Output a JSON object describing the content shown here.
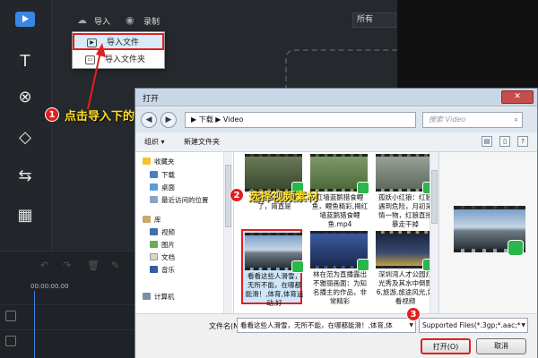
{
  "toolbar": {
    "import_label": "导入",
    "record_label": "录制",
    "filter_value": "所有"
  },
  "dropdown": {
    "items": [
      {
        "label": "导入文件",
        "icon": "play-icon"
      },
      {
        "label": "导入文件夹",
        "icon": "folder-icon"
      }
    ]
  },
  "timeline": {
    "timecode": "00:00:00.00"
  },
  "annotations": {
    "step1": {
      "num": "1",
      "text": "点击导入下的导入文件"
    },
    "step2": {
      "num": "2",
      "text": "选择视频素材"
    },
    "step3": {
      "num": "3"
    }
  },
  "dialog": {
    "title": "打开",
    "path": "▶ 下载 ▶ Video",
    "search_placeholder": "搜索 Video",
    "organize_label": "组织 ▾",
    "new_folder_label": "新建文件夹",
    "nav_items": [
      {
        "label": "收藏夹",
        "group": true
      },
      {
        "label": "下载",
        "group": false
      },
      {
        "label": "桌面",
        "group": false
      },
      {
        "label": "最近访问的位置",
        "group": false
      },
      {
        "label": "库",
        "group": true
      },
      {
        "label": "视频",
        "group": false
      },
      {
        "label": "图片",
        "group": false
      },
      {
        "label": "文档",
        "group": false
      },
      {
        "label": "音乐",
        "group": false
      },
      {
        "label": "计算机",
        "group": true
      }
    ],
    "files": [
      {
        "name": "出水芙蓉，太美了，简直是"
      },
      {
        "name": "红墙蓝鹅猎食鲤鱼，鲤鱼精彩,揭红墙蓝鹅猎食鲤鱼.mp4"
      },
      {
        "name": "孤妖小红狼：红狼遇到危险，月初采情一物，红狼直接暴走干掉"
      },
      {
        "name": "看看这些人滑雪，无所不能，在哪都能滑！,体育,体育运动,好"
      },
      {
        "name": "林在范为直播露出不雅丽画面：为知名播主的作品，非常精彩"
      },
      {
        "name": "深圳湾人才公园灯光秀及其水中倒影6,旅游,旅途风光,好看视频"
      }
    ],
    "filename_label": "文件名(N):",
    "filename_value": "看看这些人滑雪，无所不能，在哪都能滑！,体育,体",
    "filter_value": "Supported Files(*.3gp;*.aac;*",
    "open_label": "打开(O)",
    "cancel_label": "取消"
  }
}
